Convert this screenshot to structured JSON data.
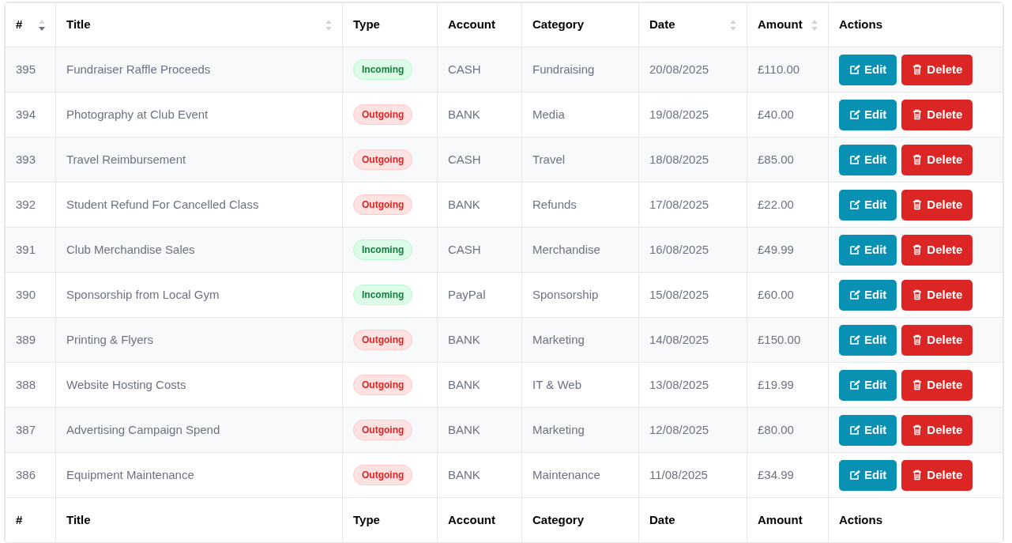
{
  "table": {
    "columns": [
      {
        "label": "#",
        "sortable": true,
        "sorted": true
      },
      {
        "label": "Title",
        "sortable": true,
        "sorted": false
      },
      {
        "label": "Type"
      },
      {
        "label": "Account"
      },
      {
        "label": "Category"
      },
      {
        "label": "Date",
        "sortable": true,
        "sorted": false
      },
      {
        "label": "Amount",
        "sortable": true,
        "sorted": false
      },
      {
        "label": "Actions"
      }
    ],
    "rows": [
      {
        "id": "395",
        "title": "Fundraiser Raffle Proceeds",
        "type": {
          "kind": "incoming",
          "label": "Incoming"
        },
        "account": "CASH",
        "category": "Fundraising",
        "date": "20/08/2025",
        "amount": "£110.00",
        "actions": [
          {
            "kind": "edit",
            "label": "Edit"
          },
          {
            "kind": "delete",
            "label": "Delete"
          }
        ]
      },
      {
        "id": "394",
        "title": "Photography at Club Event",
        "type": {
          "kind": "outgoing",
          "label": "Outgoing"
        },
        "account": "BANK",
        "category": "Media",
        "date": "19/08/2025",
        "amount": "£40.00",
        "actions": [
          {
            "kind": "edit",
            "label": "Edit"
          },
          {
            "kind": "delete",
            "label": "Delete"
          }
        ]
      },
      {
        "id": "393",
        "title": "Travel Reimbursement",
        "type": {
          "kind": "outgoing",
          "label": "Outgoing"
        },
        "account": "CASH",
        "category": "Travel",
        "date": "18/08/2025",
        "amount": "£85.00",
        "actions": [
          {
            "kind": "edit",
            "label": "Edit"
          },
          {
            "kind": "delete",
            "label": "Delete"
          }
        ]
      },
      {
        "id": "392",
        "title": "Student Refund For Cancelled Class",
        "type": {
          "kind": "outgoing",
          "label": "Outgoing"
        },
        "account": "BANK",
        "category": "Refunds",
        "date": "17/08/2025",
        "amount": "£22.00",
        "actions": [
          {
            "kind": "edit",
            "label": "Edit"
          },
          {
            "kind": "delete",
            "label": "Delete"
          }
        ]
      },
      {
        "id": "391",
        "title": "Club Merchandise Sales",
        "type": {
          "kind": "incoming",
          "label": "Incoming"
        },
        "account": "CASH",
        "category": "Merchandise",
        "date": "16/08/2025",
        "amount": "£49.99",
        "actions": [
          {
            "kind": "edit",
            "label": "Edit"
          },
          {
            "kind": "delete",
            "label": "Delete"
          }
        ]
      },
      {
        "id": "390",
        "title": "Sponsorship from Local Gym",
        "type": {
          "kind": "incoming",
          "label": "Incoming"
        },
        "account": "PayPal",
        "category": "Sponsorship",
        "date": "15/08/2025",
        "amount": "£60.00",
        "actions": [
          {
            "kind": "edit",
            "label": "Edit"
          },
          {
            "kind": "delete",
            "label": "Delete"
          }
        ]
      },
      {
        "id": "389",
        "title": "Printing & Flyers",
        "type": {
          "kind": "outgoing",
          "label": "Outgoing"
        },
        "account": "BANK",
        "category": "Marketing",
        "date": "14/08/2025",
        "amount": "£150.00",
        "actions": [
          {
            "kind": "edit",
            "label": "Edit"
          },
          {
            "kind": "delete",
            "label": "Delete"
          }
        ]
      },
      {
        "id": "388",
        "title": "Website Hosting Costs",
        "type": {
          "kind": "outgoing",
          "label": "Outgoing"
        },
        "account": "BANK",
        "category": "IT & Web",
        "date": "13/08/2025",
        "amount": "£19.99",
        "actions": [
          {
            "kind": "edit",
            "label": "Edit"
          },
          {
            "kind": "delete",
            "label": "Delete"
          }
        ]
      },
      {
        "id": "387",
        "title": "Advertising Campaign Spend",
        "type": {
          "kind": "outgoing",
          "label": "Outgoing"
        },
        "account": "BANK",
        "category": "Marketing",
        "date": "12/08/2025",
        "amount": "£80.00",
        "actions": [
          {
            "kind": "edit",
            "label": "Edit"
          },
          {
            "kind": "delete",
            "label": "Delete"
          }
        ]
      },
      {
        "id": "386",
        "title": "Equipment Maintenance",
        "type": {
          "kind": "outgoing",
          "label": "Outgoing"
        },
        "account": "BANK",
        "category": "Maintenance",
        "date": "11/08/2025",
        "amount": "£34.99",
        "actions": [
          {
            "kind": "edit",
            "label": "Edit"
          },
          {
            "kind": "delete",
            "label": "Delete"
          }
        ]
      }
    ],
    "footer": [
      "#",
      "Title",
      "Type",
      "Account",
      "Category",
      "Date",
      "Amount",
      "Actions"
    ]
  }
}
